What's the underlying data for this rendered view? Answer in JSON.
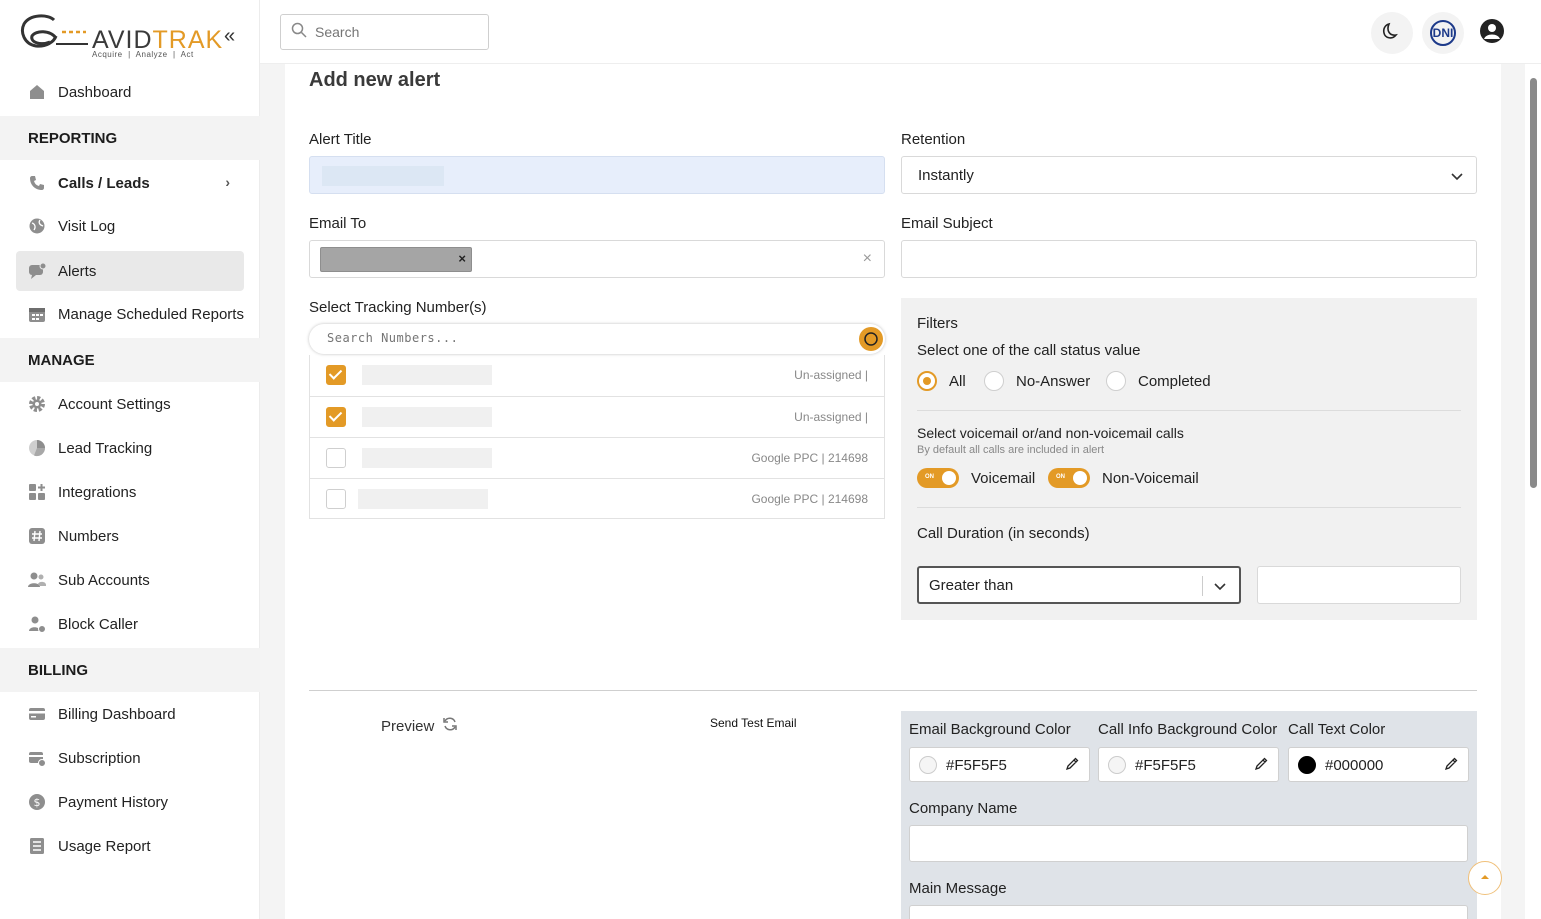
{
  "brand": {
    "name_part1": "AVID",
    "name_part2": "TRAK",
    "tagline": "Acquire  |  Analyze  |  Act",
    "accent": "#e39a26"
  },
  "sidebar": {
    "collapse_icon": "chevrons-left-icon",
    "dashboard": "Dashboard",
    "sections": {
      "reporting": "REPORTING",
      "manage": "MANAGE",
      "billing": "BILLING"
    },
    "reporting_items": [
      {
        "label": "Calls / Leads",
        "icon": "phone-icon"
      },
      {
        "label": "Visit Log",
        "icon": "globe-icon"
      },
      {
        "label": "Alerts",
        "icon": "alert-chat-icon",
        "active": true
      },
      {
        "label": "Manage Scheduled Reports",
        "icon": "calendar-icon"
      }
    ],
    "manage_items": [
      {
        "label": "Account Settings",
        "icon": "gear-icon"
      },
      {
        "label": "Lead Tracking",
        "icon": "pie-chart-icon"
      },
      {
        "label": "Integrations",
        "icon": "grid-plus-icon"
      },
      {
        "label": "Numbers",
        "icon": "hash-icon"
      },
      {
        "label": "Sub Accounts",
        "icon": "users-icon"
      },
      {
        "label": "Block Caller",
        "icon": "user-block-icon"
      }
    ],
    "billing_items": [
      {
        "label": "Billing Dashboard",
        "icon": "card-icon"
      },
      {
        "label": "Subscription",
        "icon": "card-settings-icon"
      },
      {
        "label": "Payment History",
        "icon": "dollar-circle-icon"
      },
      {
        "label": "Usage Report",
        "icon": "list-icon"
      }
    ]
  },
  "topbar": {
    "search_placeholder": "Search",
    "dni_label": "DNI"
  },
  "form": {
    "title": "Add new alert",
    "alert_title_label": "Alert Title",
    "retention_label": "Retention",
    "retention_value": "Instantly",
    "email_to_label": "Email To",
    "email_subject_label": "Email Subject",
    "tracking_label": "Select Tracking Number(s)",
    "search_numbers_placeholder": "Search Numbers...",
    "numbers": [
      {
        "checked": true,
        "source": "Un-assigned |"
      },
      {
        "checked": true,
        "source": "Un-assigned |"
      },
      {
        "checked": false,
        "source": "Google PPC | 214698"
      },
      {
        "checked": false,
        "source": "Google PPC | 214698"
      }
    ]
  },
  "filters": {
    "title": "Filters",
    "status_prompt": "Select one of the call status value",
    "status_options": [
      "All",
      "No-Answer",
      "Completed"
    ],
    "status_selected": "All",
    "voicemail_prompt": "Select voicemail or/and non-voicemail calls",
    "voicemail_hint": "By default all calls are included in alert",
    "toggle_on_text": "ON",
    "voicemail_label": "Voicemail",
    "non_voicemail_label": "Non-Voicemail",
    "duration_label": "Call Duration (in seconds)",
    "duration_operator": "Greater than"
  },
  "email_design": {
    "preview_label": "Preview",
    "send_test_label": "Send Test Email",
    "email_bg_label": "Email Background Color",
    "email_bg_value": "#F5F5F5",
    "call_info_bg_label": "Call Info Background Color",
    "call_info_bg_value": "#F5F5F5",
    "call_text_label": "Call Text Color",
    "call_text_value": "#000000",
    "company_name_label": "Company Name",
    "main_message_label": "Main Message"
  }
}
